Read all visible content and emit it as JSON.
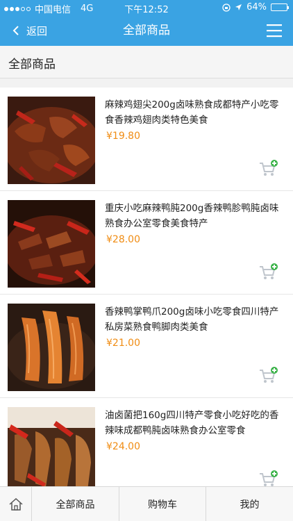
{
  "status_bar": {
    "carrier": "中国电信",
    "network": "4G",
    "time": "下午12:52",
    "battery_text": "64%",
    "battery_level": 0.64
  },
  "navbar": {
    "back_label": "返回",
    "title": "全部商品"
  },
  "section": {
    "title": "全部商品"
  },
  "colors": {
    "primary": "#3aa3e3",
    "price": "#f08c13",
    "cart_badge": "#3cb34a"
  },
  "products": [
    {
      "name": "麻辣鸡翅尖200g卤味熟食成都特产小吃零食香辣鸡翅肉类特色美食",
      "price": "¥19.80"
    },
    {
      "name": "重庆小吃麻辣鸭肫200g香辣鸭胗鸭肫卤味熟食办公室零食美食特产",
      "price": "¥28.00"
    },
    {
      "name": "香辣鸭掌鸭爪200g卤味小吃零食四川特产私房菜熟食鸭脚肉类美食",
      "price": "¥21.00"
    },
    {
      "name": "油卤菌把160g四川特产零食小吃好吃的香辣味成都鸭肫卤味熟食办公室零食",
      "price": "¥24.00"
    }
  ],
  "tab_bar": {
    "home_icon": "home-icon",
    "tabs": [
      "全部商品",
      "购物车",
      "我的"
    ]
  }
}
